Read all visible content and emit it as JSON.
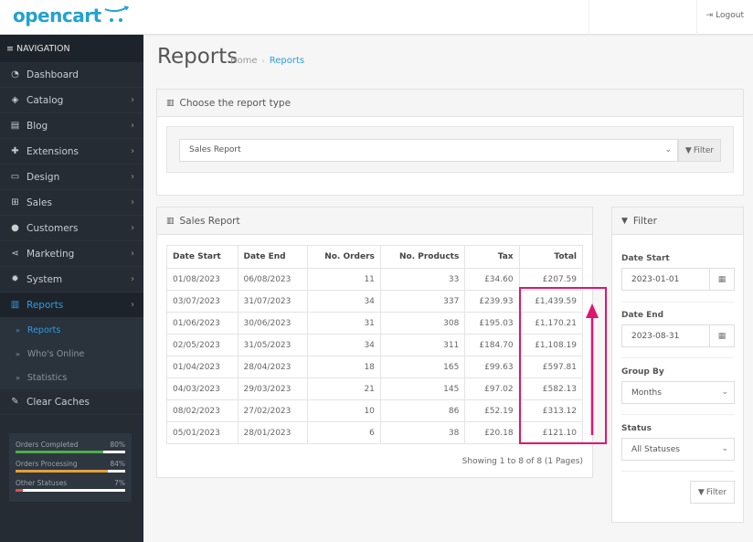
{
  "header": {
    "logo_text": "opencart",
    "logout_label": "Logout"
  },
  "sidebar": {
    "nav_title": "NAVIGATION",
    "items": [
      {
        "label": "Dashboard",
        "icon": "dashboard-icon",
        "glyph": "◔",
        "has_chevron": false
      },
      {
        "label": "Catalog",
        "icon": "tag-icon",
        "glyph": "◈",
        "has_chevron": true
      },
      {
        "label": "Blog",
        "icon": "newspaper-icon",
        "glyph": "▤",
        "has_chevron": true
      },
      {
        "label": "Extensions",
        "icon": "puzzle-icon",
        "glyph": "✚",
        "has_chevron": true
      },
      {
        "label": "Design",
        "icon": "monitor-icon",
        "glyph": "▭",
        "has_chevron": true
      },
      {
        "label": "Sales",
        "icon": "cart-icon",
        "glyph": "⊞",
        "has_chevron": true
      },
      {
        "label": "Customers",
        "icon": "user-icon",
        "glyph": "●",
        "has_chevron": true
      },
      {
        "label": "Marketing",
        "icon": "share-icon",
        "glyph": "⋖",
        "has_chevron": true
      },
      {
        "label": "System",
        "icon": "gear-icon",
        "glyph": "✹",
        "has_chevron": true
      },
      {
        "label": "Reports",
        "icon": "bar-chart-icon",
        "glyph": "▥",
        "has_chevron": true,
        "active": true
      }
    ],
    "sub_items": [
      {
        "label": "Reports",
        "active": true
      },
      {
        "label": "Who's Online",
        "active": false
      },
      {
        "label": "Statistics",
        "active": false
      }
    ],
    "after_item": {
      "label": "Clear Caches",
      "icon": "wrench-icon",
      "glyph": "✎"
    },
    "stats": [
      {
        "label": "Orders Completed",
        "percent_text": "80%",
        "value": 80,
        "color": "#4cae4c"
      },
      {
        "label": "Orders Processing",
        "percent_text": "84%",
        "value": 84,
        "color": "#e39f3f"
      },
      {
        "label": "Other Statuses",
        "percent_text": "7%",
        "value": 7,
        "color": "#d9534f"
      }
    ]
  },
  "page": {
    "title": "Reports",
    "breadcrumb": {
      "home": "Home",
      "separator": "›",
      "current": "Reports"
    }
  },
  "report_type_panel": {
    "title": "Choose the report type",
    "selected": "Sales Report",
    "filter_label": "Filter"
  },
  "sales_panel": {
    "title": "Sales Report",
    "columns": [
      "Date Start",
      "Date End",
      "No. Orders",
      "No. Products",
      "Tax",
      "Total"
    ],
    "rows": [
      [
        "01/08/2023",
        "06/08/2023",
        "11",
        "33",
        "£34.60",
        "£207.59"
      ],
      [
        "03/07/2023",
        "31/07/2023",
        "34",
        "337",
        "£239.93",
        "£1,439.59"
      ],
      [
        "01/06/2023",
        "30/06/2023",
        "31",
        "308",
        "£195.03",
        "£1,170.21"
      ],
      [
        "02/05/2023",
        "31/05/2023",
        "34",
        "311",
        "£184.70",
        "£1,108.19"
      ],
      [
        "01/04/2023",
        "28/04/2023",
        "18",
        "165",
        "£99.63",
        "£597.81"
      ],
      [
        "04/03/2023",
        "29/03/2023",
        "21",
        "145",
        "£97.02",
        "£582.13"
      ],
      [
        "08/02/2023",
        "27/02/2023",
        "10",
        "86",
        "£52.19",
        "£313.12"
      ],
      [
        "05/01/2023",
        "28/01/2023",
        "6",
        "38",
        "£20.18",
        "£121.10"
      ]
    ],
    "pagination_text": "Showing 1 to 8 of 8 (1 Pages)"
  },
  "filter_panel": {
    "title": "Filter",
    "date_start_label": "Date Start",
    "date_start_value": "2023-01-01",
    "date_end_label": "Date End",
    "date_end_value": "2023-08-31",
    "group_by_label": "Group By",
    "group_by_value": "Months",
    "status_label": "Status",
    "status_value": "All Statuses",
    "filter_label": "Filter"
  },
  "annotation": {
    "color": "#e0156e"
  }
}
